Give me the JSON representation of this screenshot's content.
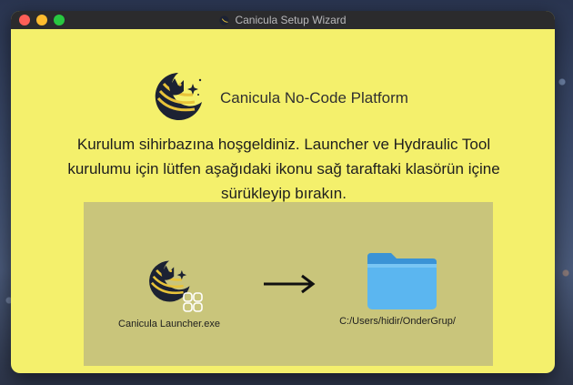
{
  "window": {
    "title": "Canicula Setup Wizard"
  },
  "brand": {
    "name": "Canicula No-Code Platform"
  },
  "welcome": {
    "message": "Kurulum sihirbazına hoşgeldiniz. Launcher ve Hydraulic Tool kurulumu için lütfen aşağıdaki ikonu sağ taraftaki klasörün içine sürükleyip bırakın."
  },
  "install": {
    "app_label": "Canicula Launcher.exe",
    "folder_label": "C:/Users/hidir/OnderGrup/"
  },
  "colors": {
    "window_bg": "#f4f06c",
    "drop_area_bg": "#c9c57b",
    "titlebar_bg": "#2b2b2d",
    "logo_navy": "#1c2233",
    "logo_gold": "#e8c33a",
    "folder_blue": "#5bb6f0"
  },
  "icons": {
    "app_logo": "canicula-logo-icon",
    "alias_badge": "alias-shortcut-icon",
    "arrow": "arrow-right-icon",
    "folder": "folder-icon"
  }
}
